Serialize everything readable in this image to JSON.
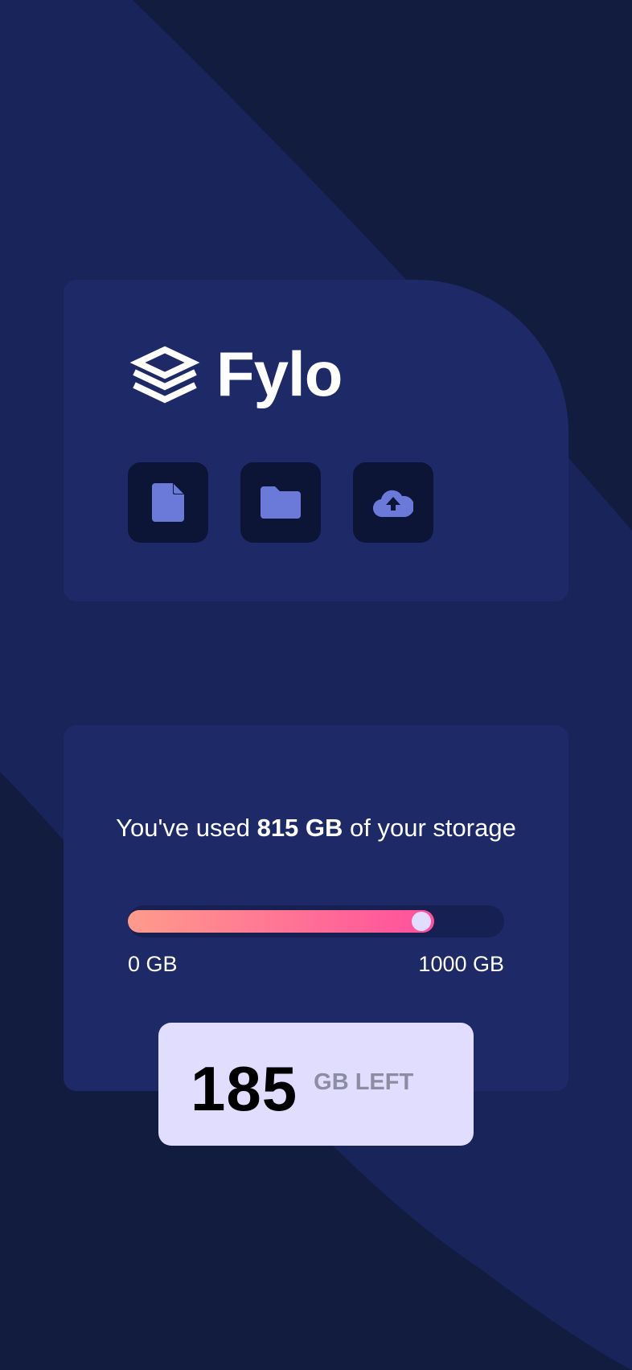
{
  "brand": {
    "name": "Fylo",
    "logo_icon": "stacked-layers-icon"
  },
  "toolbar": {
    "buttons": [
      {
        "icon": "document-icon",
        "label": "Files"
      },
      {
        "icon": "folder-icon",
        "label": "Folders"
      },
      {
        "icon": "cloud-upload-icon",
        "label": "Upload"
      }
    ]
  },
  "storage": {
    "prefix": "You've used ",
    "used_amount": "815 GB",
    "suffix": " of your storage",
    "used_value": 815,
    "total_value": 1000,
    "min_label": "0 GB",
    "max_label": "1000 GB",
    "remaining_number": "185",
    "remaining_unit": "GB LEFT"
  },
  "colors": {
    "background": "#121c3f",
    "card": "#1e2a68",
    "icon_button": "#0c1535",
    "icon": "#6b7ad8",
    "bar_gradient_start": "#ff9b8b",
    "bar_gradient_end": "#ff4f9d",
    "knob": "#e1ddff",
    "remaining_box": "#e1ddff"
  }
}
